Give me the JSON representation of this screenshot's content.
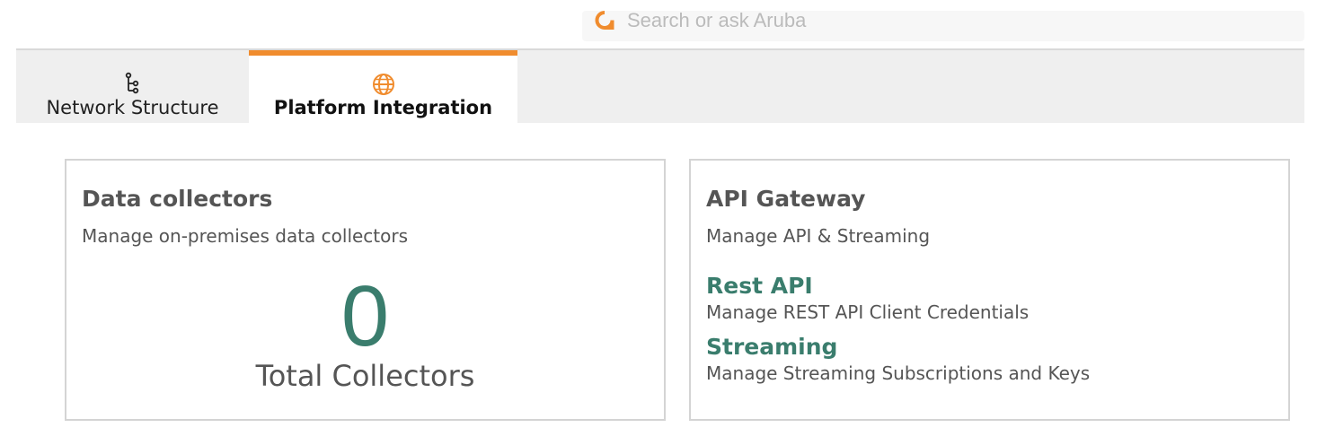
{
  "search": {
    "placeholder": "Search or ask Aruba"
  },
  "tabs": [
    {
      "label": "Network Structure",
      "icon": "hierarchy-icon",
      "active": false
    },
    {
      "label": "Platform Integration",
      "icon": "globe-icon",
      "active": true
    }
  ],
  "collectors_card": {
    "title": "Data collectors",
    "subtitle": "Manage on-premises data collectors",
    "count": "0",
    "count_label": "Total Collectors"
  },
  "api_card": {
    "title": "API Gateway",
    "subtitle": "Manage API & Streaming",
    "links": [
      {
        "title": "Rest API",
        "description": "Manage REST API Client Credentials"
      },
      {
        "title": "Streaming",
        "description": "Manage Streaming Subscriptions and Keys"
      }
    ]
  },
  "colors": {
    "accent": "#f08c2e",
    "link": "#3a7d6d",
    "text": "#555555"
  }
}
